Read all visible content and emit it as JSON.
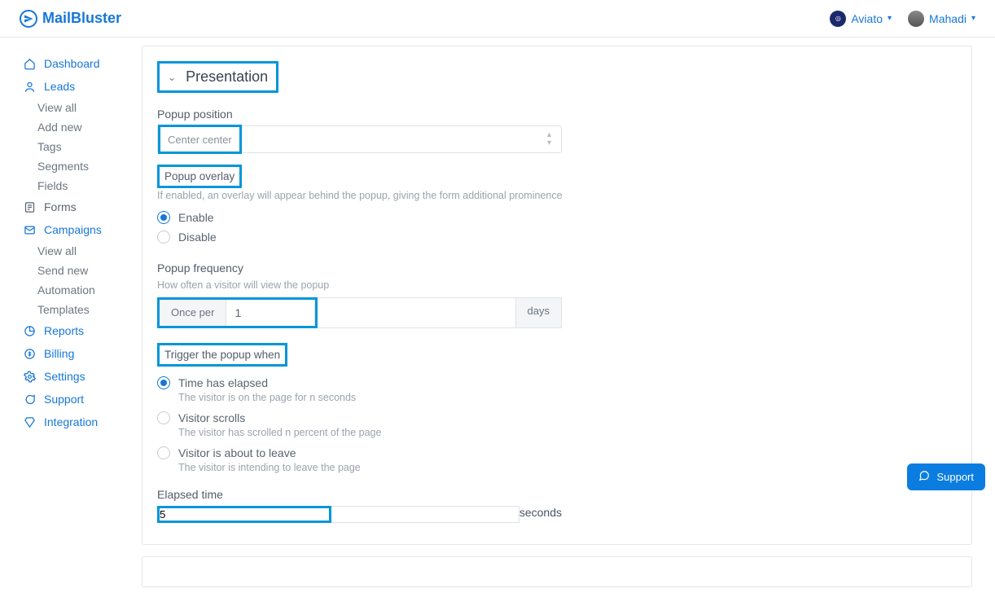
{
  "brand": {
    "name": "MailBluster"
  },
  "header": {
    "workspace": "Aviato",
    "user": "Mahadi"
  },
  "sidebar": {
    "dashboard": "Dashboard",
    "leads": "Leads",
    "leads_sub": {
      "view_all": "View all",
      "add_new": "Add new",
      "tags": "Tags",
      "segments": "Segments",
      "fields": "Fields"
    },
    "forms": "Forms",
    "campaigns": "Campaigns",
    "campaigns_sub": {
      "view_all": "View all",
      "send_new": "Send new",
      "automation": "Automation",
      "templates": "Templates"
    },
    "reports": "Reports",
    "billing": "Billing",
    "settings": "Settings",
    "support": "Support",
    "integration": "Integration"
  },
  "presentation": {
    "title": "Presentation",
    "popup_position_label": "Popup position",
    "popup_position_value": "Center center",
    "popup_overlay_label": "Popup overlay",
    "popup_overlay_help": "If enabled, an overlay will appear behind the popup, giving the form additional prominence",
    "enable": "Enable",
    "disable": "Disable",
    "popup_frequency_label": "Popup frequency",
    "popup_frequency_help": "How often a visitor will view the popup",
    "once_per": "Once per",
    "frequency_value": "1",
    "days": "days",
    "trigger_label": "Trigger the popup when",
    "trigger_time_elapsed": "Time has elapsed",
    "trigger_time_elapsed_help": "The visitor is on the page for n seconds",
    "trigger_scrolls": "Visitor scrolls",
    "trigger_scrolls_help": "The visitor has scrolled n percent of the page",
    "trigger_leave": "Visitor is about to leave",
    "trigger_leave_help": "The visitor is intending to leave the page",
    "elapsed_time_label": "Elapsed time",
    "elapsed_time_value": "5",
    "seconds": "seconds"
  },
  "support_button": "Support"
}
